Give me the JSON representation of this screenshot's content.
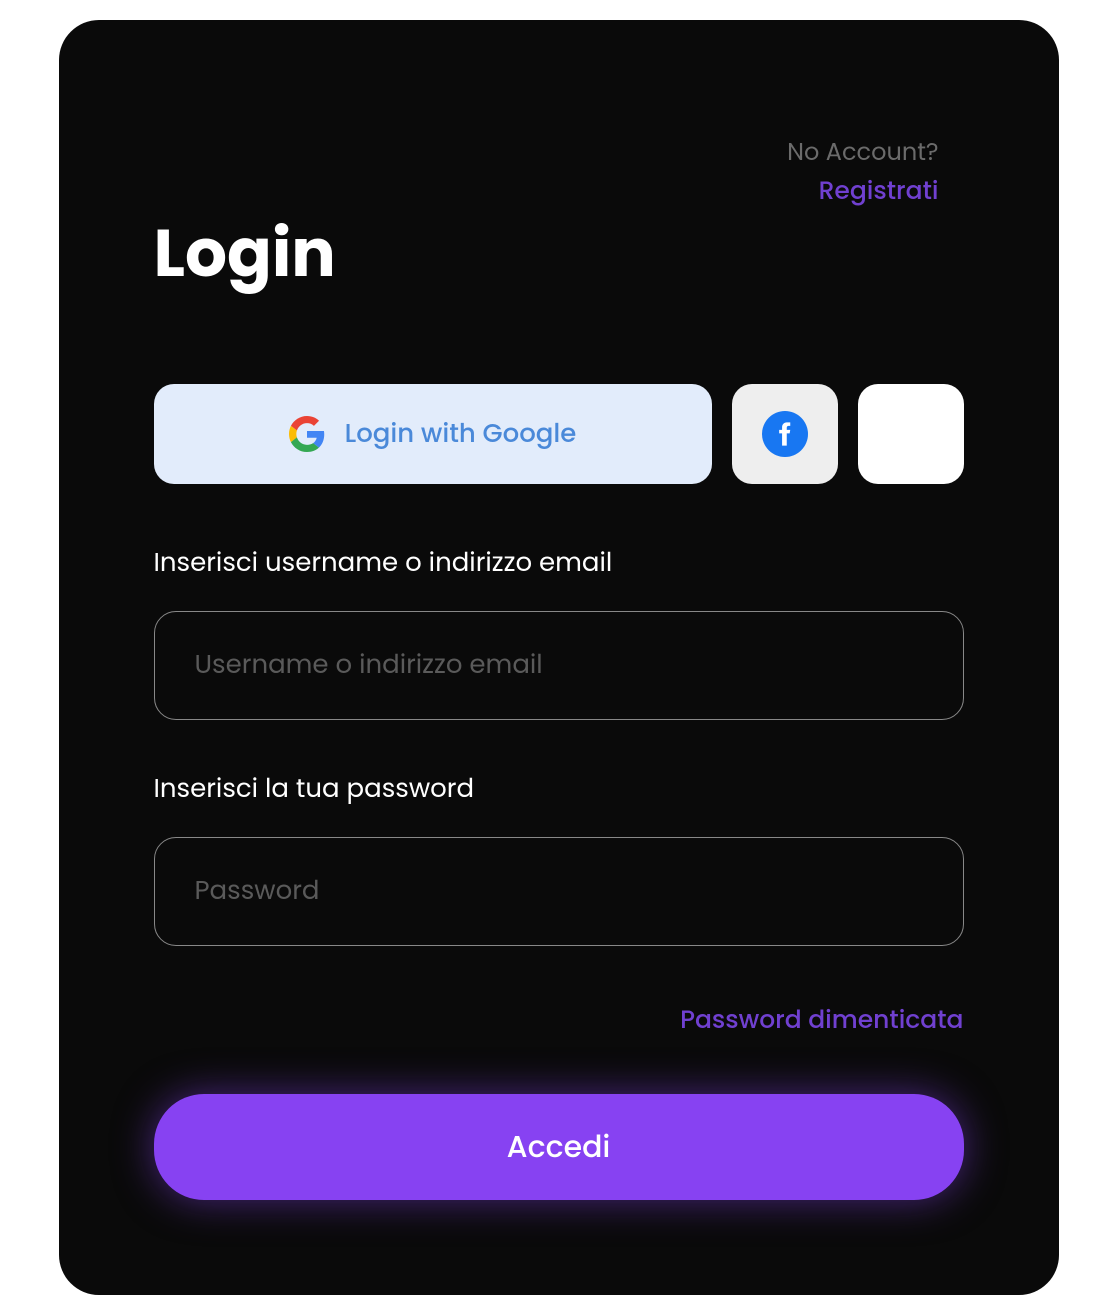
{
  "header": {
    "no_account_text": "No Account?",
    "register_text": "Registrati"
  },
  "title": "Login",
  "social": {
    "google_label": "Login with Google"
  },
  "fields": {
    "username": {
      "label": "Inserisci username o indirizzo email",
      "placeholder": "Username o indirizzo email"
    },
    "password": {
      "label": "Inserisci la tua password",
      "placeholder": "Password"
    }
  },
  "links": {
    "forgot_password": "Password dimenticata"
  },
  "buttons": {
    "submit": "Accedi"
  },
  "colors": {
    "accent": "#8742f2",
    "link": "#7040d0",
    "google_bg": "#e2ecfb",
    "google_text": "#4a89d9",
    "facebook": "#1877f2"
  }
}
